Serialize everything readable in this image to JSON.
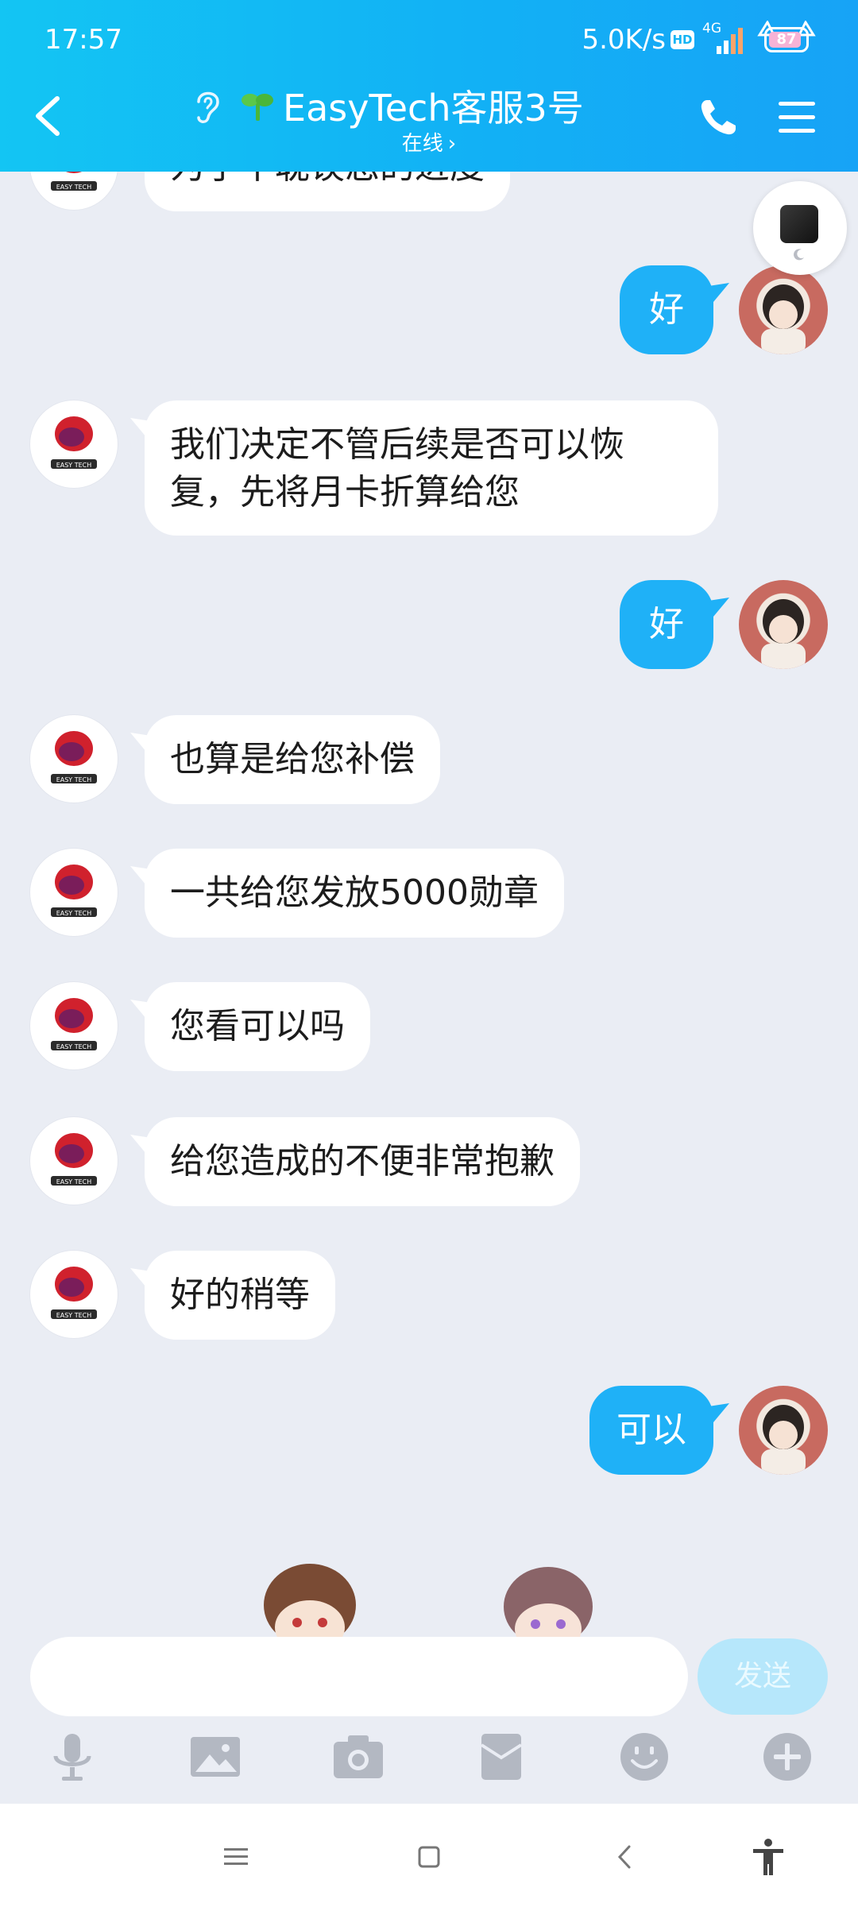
{
  "status_bar": {
    "time": "17:57",
    "net_speed": "5.0K/s",
    "hd": "HD",
    "network": "4G",
    "battery": "87"
  },
  "header": {
    "title": "EasyTech客服3号",
    "subtitle": "在线",
    "subtitle_arrow": "›"
  },
  "messages": [
    {
      "side": "in",
      "text": "为了不耽误您的进度"
    },
    {
      "side": "out",
      "text": "好"
    },
    {
      "side": "in",
      "text": "我们决定不管后续是否可以恢复，先将月卡折算给您"
    },
    {
      "side": "out",
      "text": "好"
    },
    {
      "side": "in",
      "text": "也算是给您补偿"
    },
    {
      "side": "in",
      "text": "一共给您发放5000勋章"
    },
    {
      "side": "in",
      "text": "您看可以吗"
    },
    {
      "side": "in",
      "text": "给您造成的不便非常抱歉"
    },
    {
      "side": "in",
      "text": "好的稍等"
    },
    {
      "side": "out",
      "text": "可以"
    }
  ],
  "input": {
    "placeholder": "",
    "send_label": "发送"
  },
  "toolbar": [
    "microphone-icon",
    "image-icon",
    "camera-icon",
    "red-packet-icon",
    "emoji-icon",
    "plus-icon"
  ],
  "colors": {
    "header_start": "#13c5f3",
    "header_end": "#17a3f6",
    "out_bubble": "#1fb1f7",
    "background": "#eaedf4",
    "send_disabled": "#b6e7fb"
  }
}
